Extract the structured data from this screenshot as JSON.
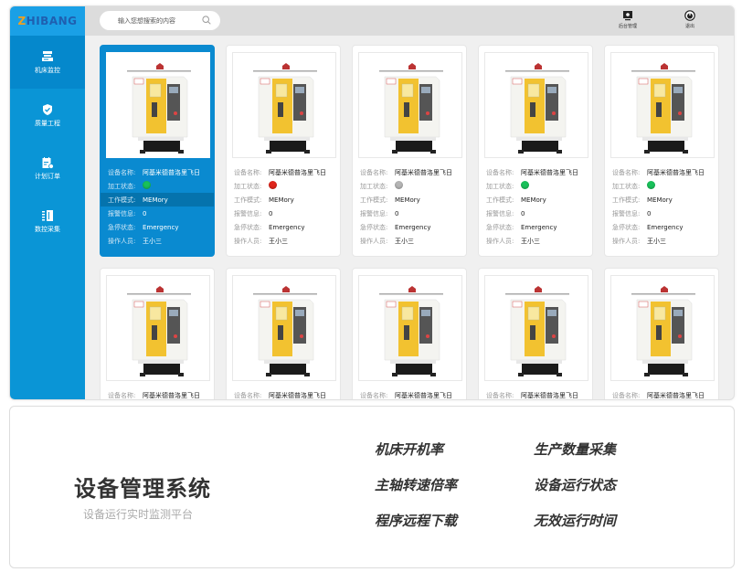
{
  "app": {
    "logo_text_a": "Z",
    "logo_text_b": "HIBANG"
  },
  "search": {
    "placeholder": "输入您想搜索的内容"
  },
  "topbar": {
    "admin_label": "后台管理",
    "logout_label": "退出"
  },
  "sidebar": {
    "items": [
      {
        "label": "机床监控",
        "icon": "machine-monitor-icon",
        "active": true
      },
      {
        "label": "质量工程",
        "icon": "shield-check-icon",
        "active": false
      },
      {
        "label": "计划订单",
        "icon": "calendar-order-icon",
        "active": false
      },
      {
        "label": "数控采集",
        "icon": "data-collect-icon",
        "active": false
      }
    ]
  },
  "card_labels": {
    "name": "设备名称:",
    "status": "加工状态:",
    "mode": "工作模式:",
    "alarm": "报警信息:",
    "estop": "急停状态:",
    "operator": "操作人员:"
  },
  "status_colors": {
    "green": "#19c15a",
    "red": "#e0251b",
    "gray": "#b5b5b5"
  },
  "devices": [
    {
      "name": "阿基米德普洛里飞日",
      "status": "green",
      "mode": "MEMory",
      "alarm": "0",
      "estop": "Emergency",
      "operator": "王小三",
      "selected": true
    },
    {
      "name": "阿基米德普洛里飞日",
      "status": "red",
      "mode": "MEMory",
      "alarm": "0",
      "estop": "Emergency",
      "operator": "王小三"
    },
    {
      "name": "阿基米德普洛里飞日",
      "status": "gray",
      "mode": "MEMory",
      "alarm": "0",
      "estop": "Emergency",
      "operator": "王小三"
    },
    {
      "name": "阿基米德普洛里飞日",
      "status": "green",
      "mode": "MEMory",
      "alarm": "0",
      "estop": "Emergency",
      "operator": "王小三"
    },
    {
      "name": "阿基米德普洛里飞日",
      "status": "green",
      "mode": "MEMory",
      "alarm": "0",
      "estop": "Emergency",
      "operator": "王小三"
    },
    {
      "name": "阿基米德普洛里飞日"
    },
    {
      "name": "阿基米德普洛里飞日"
    },
    {
      "name": "阿基米德普洛里飞日"
    },
    {
      "name": "阿基米德普洛里飞日"
    },
    {
      "name": "阿基米德普洛里飞日"
    }
  ],
  "promo": {
    "title": "设备管理系统",
    "subtitle": "设备运行实时监测平台",
    "features": [
      "机床开机率",
      "生产数量采集",
      "主轴转速倍率",
      "设备运行状态",
      "程序远程下载",
      "无效运行时间"
    ]
  }
}
